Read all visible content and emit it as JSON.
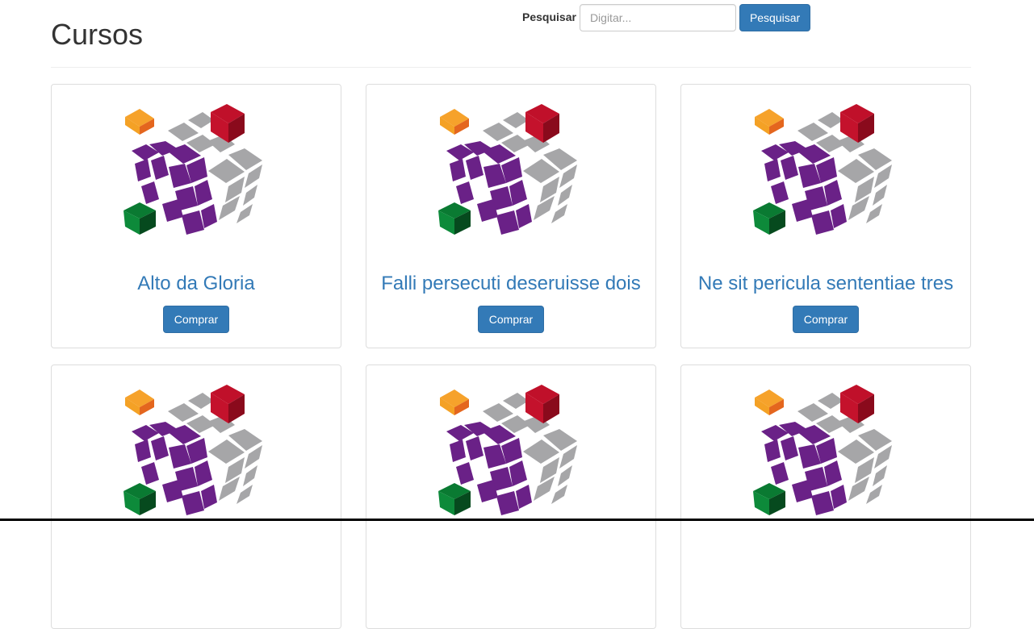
{
  "header": {
    "title": "Cursos",
    "search": {
      "label": "Pesquisar",
      "placeholder": "Digitar...",
      "value": "",
      "button_label": "Pesquisar"
    }
  },
  "courses": [
    {
      "title": "Alto da Gloria",
      "button_label": "Comprar",
      "image_icon": "rubik-cube-logo"
    },
    {
      "title": "Falli persecuti deseruisse dois",
      "button_label": "Comprar",
      "image_icon": "rubik-cube-logo"
    },
    {
      "title": "Ne sit pericula sententiae tres",
      "button_label": "Comprar",
      "image_icon": "rubik-cube-logo"
    },
    {
      "title": "",
      "button_label": "",
      "image_icon": "rubik-cube-logo"
    },
    {
      "title": "",
      "button_label": "",
      "image_icon": "rubik-cube-logo"
    },
    {
      "title": "",
      "button_label": "",
      "image_icon": "rubik-cube-logo"
    }
  ],
  "colors": {
    "accent": "#337ab7",
    "cube_purple": "#6a2187",
    "cube_gray": "#a6a6a8",
    "cube_red": "#c0102a",
    "cube_orange": "#f6a22b",
    "cube_green": "#0a7a32"
  }
}
